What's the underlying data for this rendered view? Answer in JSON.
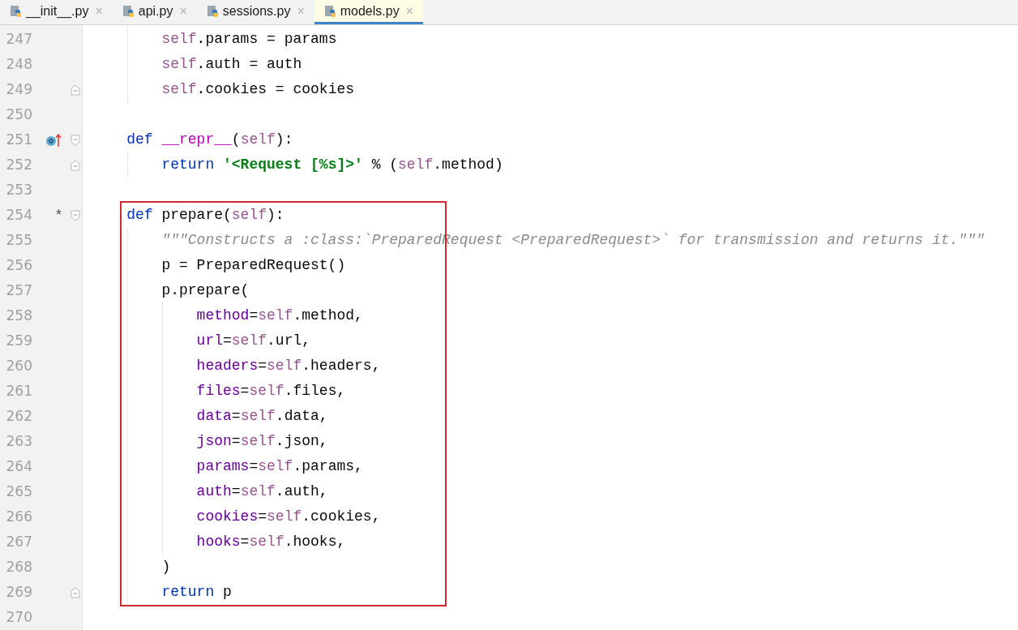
{
  "tabs": [
    {
      "label": "__init__.py",
      "close": "×",
      "selected": false
    },
    {
      "label": "api.py",
      "close": "×",
      "selected": false
    },
    {
      "label": "sessions.py",
      "close": "×",
      "selected": false
    },
    {
      "label": "models.py",
      "close": "×",
      "selected": true
    }
  ],
  "lines": [
    {
      "children": [
        {
          "number": "247",
          "highlighted": false,
          "tokens": [
            {
              "kind": "self",
              "text": "self"
            },
            {
              "kind": "plain",
              "text": ".params = params"
            }
          ]
        },
        {
          "number": "248",
          "highlighted": false,
          "tokens": [
            {
              "kind": "self",
              "text": "self"
            },
            {
              "kind": "plain",
              "text": ".auth = auth"
            }
          ]
        },
        {
          "number": "249",
          "highlighted": false,
          "fold_end": true,
          "tokens": [
            {
              "kind": "self",
              "text": "self"
            },
            {
              "kind": "plain",
              "text": ".cookies = cookies"
            }
          ]
        }
      ]
    },
    {
      "number": "250",
      "highlighted": false
    },
    {
      "number": "251",
      "highlighted": false,
      "fold_start": true,
      "overridden": true,
      "tokens": [
        {
          "kind": "kw",
          "text": "def"
        },
        {
          "kind": "magic",
          "text": " __repr__"
        },
        {
          "kind": "plain",
          "text": "("
        },
        {
          "kind": "self",
          "text": "self"
        },
        {
          "kind": "plain",
          "text": "):"
        }
      ],
      "children": [
        {
          "number": "252",
          "highlighted": false,
          "fold_end": true,
          "tokens": [
            {
              "kind": "kw",
              "text": "return"
            },
            {
              "kind": "str",
              "text": " '<Request [%s]>'"
            },
            {
              "kind": "plain",
              "text": " % ("
            },
            {
              "kind": "self",
              "text": "self"
            },
            {
              "kind": "plain",
              "text": ".method)"
            }
          ]
        }
      ]
    },
    {
      "number": "253",
      "highlighted": false
    },
    {
      "number": "254",
      "highlighted": true,
      "fold_start": true,
      "gutter_text": "*",
      "tokens": [
        {
          "kind": "kw",
          "text": "def"
        },
        {
          "kind": "plain",
          "text": " prepare("
        },
        {
          "kind": "self",
          "text": "self"
        },
        {
          "kind": "plain",
          "text": "):"
        }
      ],
      "children": [
        {
          "number": "255",
          "highlighted": true,
          "tokens": [
            {
              "kind": "doc",
              "text": "\"\"\"Constructs a :class:`PreparedRequest <PreparedRequest>` for transmission and returns it.\"\"\""
            }
          ]
        },
        {
          "number": "256",
          "highlighted": true,
          "tokens": [
            {
              "kind": "plain",
              "text": "p = PreparedRequest()"
            }
          ]
        },
        {
          "number": "257",
          "highlighted": true,
          "tokens": [
            {
              "kind": "plain",
              "text": "p.prepare("
            }
          ],
          "children": [
            {
              "number": "258",
              "highlighted": true,
              "tokens": [
                {
                  "kind": "arg",
                  "text": "method"
                },
                {
                  "kind": "plain",
                  "text": "="
                },
                {
                  "kind": "self",
                  "text": "self"
                },
                {
                  "kind": "plain",
                  "text": ".method,"
                }
              ]
            },
            {
              "number": "259",
              "highlighted": true,
              "tokens": [
                {
                  "kind": "arg",
                  "text": "url"
                },
                {
                  "kind": "plain",
                  "text": "="
                },
                {
                  "kind": "self",
                  "text": "self"
                },
                {
                  "kind": "plain",
                  "text": ".url,"
                }
              ]
            },
            {
              "number": "260",
              "highlighted": true,
              "tokens": [
                {
                  "kind": "arg",
                  "text": "headers"
                },
                {
                  "kind": "plain",
                  "text": "="
                },
                {
                  "kind": "self",
                  "text": "self"
                },
                {
                  "kind": "plain",
                  "text": ".headers,"
                }
              ]
            },
            {
              "number": "261",
              "highlighted": true,
              "tokens": [
                {
                  "kind": "arg",
                  "text": "files"
                },
                {
                  "kind": "plain",
                  "text": "="
                },
                {
                  "kind": "self",
                  "text": "self"
                },
                {
                  "kind": "plain",
                  "text": ".files,"
                }
              ]
            },
            {
              "number": "262",
              "highlighted": true,
              "tokens": [
                {
                  "kind": "arg",
                  "text": "data"
                },
                {
                  "kind": "plain",
                  "text": "="
                },
                {
                  "kind": "self",
                  "text": "self"
                },
                {
                  "kind": "plain",
                  "text": ".data,"
                }
              ]
            },
            {
              "number": "263",
              "highlighted": true,
              "tokens": [
                {
                  "kind": "arg",
                  "text": "json"
                },
                {
                  "kind": "plain",
                  "text": "="
                },
                {
                  "kind": "self",
                  "text": "self"
                },
                {
                  "kind": "plain",
                  "text": ".json,"
                }
              ]
            },
            {
              "number": "264",
              "highlighted": true,
              "tokens": [
                {
                  "kind": "arg",
                  "text": "params"
                },
                {
                  "kind": "plain",
                  "text": "="
                },
                {
                  "kind": "self",
                  "text": "self"
                },
                {
                  "kind": "plain",
                  "text": ".params,"
                }
              ]
            },
            {
              "number": "265",
              "highlighted": true,
              "tokens": [
                {
                  "kind": "arg",
                  "text": "auth"
                },
                {
                  "kind": "plain",
                  "text": "="
                },
                {
                  "kind": "self",
                  "text": "self"
                },
                {
                  "kind": "plain",
                  "text": ".auth,"
                }
              ]
            },
            {
              "number": "266",
              "highlighted": true,
              "tokens": [
                {
                  "kind": "arg",
                  "text": "cookies"
                },
                {
                  "kind": "plain",
                  "text": "="
                },
                {
                  "kind": "self",
                  "text": "self"
                },
                {
                  "kind": "plain",
                  "text": ".cookies,"
                }
              ]
            },
            {
              "number": "267",
              "highlighted": true,
              "tokens": [
                {
                  "kind": "arg",
                  "text": "hooks"
                },
                {
                  "kind": "plain",
                  "text": "="
                },
                {
                  "kind": "self",
                  "text": "self"
                },
                {
                  "kind": "plain",
                  "text": ".hooks,"
                }
              ]
            }
          ]
        },
        {
          "number": "268",
          "highlighted": true,
          "tokens": [
            {
              "kind": "plain",
              "text": ")"
            }
          ]
        },
        {
          "number": "269",
          "highlighted": true,
          "fold_end": true,
          "tokens": [
            {
              "kind": "kw",
              "text": "return"
            },
            {
              "kind": "plain",
              "text": " p"
            }
          ]
        }
      ]
    },
    {
      "number": "270",
      "highlighted": false
    }
  ]
}
